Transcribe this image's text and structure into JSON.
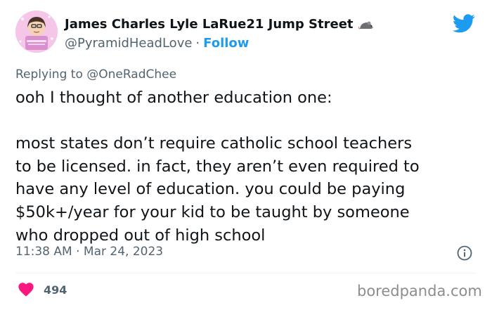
{
  "author": {
    "display_name": "James Charles Lyle LaRue21 Jump Street",
    "handle": "@PyramidHeadLove",
    "follow_label": "Follow",
    "separator": "·",
    "avatar_icon": "avatar-image",
    "name_emoji_icon": "rat-icon"
  },
  "brand": {
    "icon": "twitter-bird-icon",
    "color": "#1d9bf0"
  },
  "reply": {
    "prefix": "Replying to",
    "target": "@OneRadChee"
  },
  "tweet": {
    "lines": [
      "ooh I thought of another education one:",
      "most states don’t require catholic school teachers",
      "to be licensed. in fact, they aren’t even required to",
      "have any level of education. you could be paying",
      "$50k+/year for your kid to be taught by someone",
      "who dropped out of high school"
    ],
    "time": "11:38 AM",
    "date": "Mar 24, 2023",
    "separator": "·"
  },
  "actions": {
    "like_count": "494",
    "like_icon": "heart-icon",
    "like_color": "#f91880",
    "info_icon": "info-icon"
  },
  "watermark": {
    "text": "boredpanda.com"
  }
}
